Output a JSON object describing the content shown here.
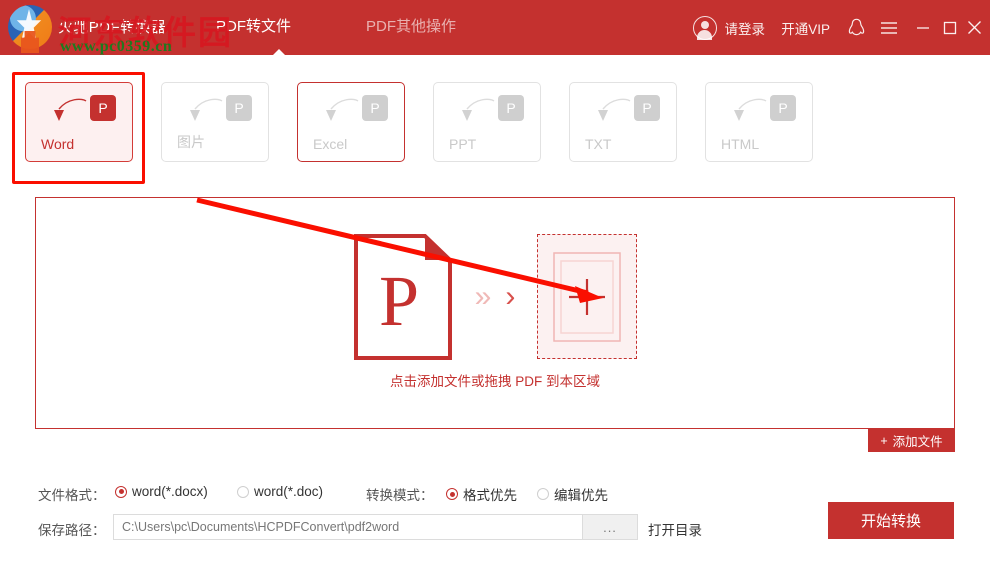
{
  "window": {
    "app_title": "火驰PDF转换器",
    "brand_red": "#c4312f"
  },
  "nav": {
    "items": [
      {
        "label": "PDF转文件",
        "active": true
      },
      {
        "label": "PDF其他操作",
        "active": false
      }
    ]
  },
  "titlebar_right": {
    "login_label": "请登录",
    "vip_label": "开通VIP",
    "icons": [
      "avatar-icon",
      "qq-icon",
      "menu-icon",
      "minimize-icon",
      "maximize-icon",
      "close-icon"
    ]
  },
  "tiles": [
    {
      "label": "Word",
      "badge": "P",
      "state": "selected"
    },
    {
      "label": "图片",
      "badge": "P",
      "state": "normal"
    },
    {
      "label": "Excel",
      "badge": "P",
      "state": "hover"
    },
    {
      "label": "PPT",
      "badge": "P",
      "state": "normal"
    },
    {
      "label": "TXT",
      "badge": "P",
      "state": "normal"
    },
    {
      "label": "HTML",
      "badge": "P",
      "state": "normal"
    }
  ],
  "drop": {
    "doc_letter": "P",
    "chevron_double": "»",
    "chevron_single": "›",
    "plus": "+",
    "hint": "点击添加文件或拖拽 PDF 到本区域",
    "add_file_label": "添加文件",
    "add_file_plus": "+"
  },
  "options": {
    "file_format_label": "文件格式：",
    "file_format_choices": [
      {
        "label": "word(*.docx)",
        "checked": true
      },
      {
        "label": "word(*.doc)",
        "checked": false
      }
    ],
    "convert_mode_label": "转换模式：",
    "convert_mode_choices": [
      {
        "label": "格式优先",
        "checked": true
      },
      {
        "label": "编辑优先",
        "checked": false
      }
    ],
    "save_path_label": "保存路径：",
    "save_path_value": "C:\\Users\\pc\\Documents\\HCPDFConvert\\pdf2word",
    "browse_label": "...",
    "open_dir_label": "打开目录",
    "start_label": "开始转换"
  },
  "watermark": {
    "main": "河东软件园",
    "sub": "www.pc0359.cn"
  }
}
